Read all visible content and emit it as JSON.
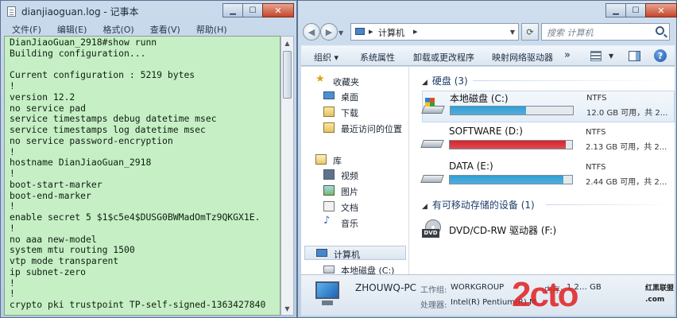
{
  "notepad": {
    "title": "dianjiaoguan.log - 记事本",
    "menu": [
      "文件(F)",
      "编辑(E)",
      "格式(O)",
      "查看(V)",
      "帮助(H)"
    ],
    "lines": [
      "DianJiaoGuan_2918#show runn",
      "Building configuration...",
      "",
      "Current configuration : 5219 bytes",
      "!",
      "version 12.2",
      "no service pad",
      "service timestamps debug datetime msec",
      "service timestamps log datetime msec",
      "no service password-encryption",
      "!",
      "hostname DianJiaoGuan_2918",
      "!",
      "boot-start-marker",
      "boot-end-marker",
      "!",
      "enable secret 5 $1$c5e4$DUSG0BWMadOmTz9QKGX1E.",
      "!",
      "no aaa new-model",
      "system mtu routing 1500",
      "vtp mode transparent",
      "ip subnet-zero",
      "!",
      "!",
      "crypto pki trustpoint TP-self-signed-1363427840"
    ]
  },
  "explorer": {
    "breadcrumb": "计算机",
    "search_placeholder": "搜索 计算机",
    "toolbar": [
      "组织",
      "系统属性",
      "卸载或更改程序",
      "映射网络驱动器"
    ],
    "more": "»",
    "nav": {
      "favorites": "收藏夹",
      "desktop": "桌面",
      "downloads": "下载",
      "recent": "最近访问的位置",
      "libraries": "库",
      "videos": "视频",
      "pictures": "图片",
      "documents": "文档",
      "music": "音乐",
      "computer": "计算机",
      "local_disk": "本地磁盘 (C:)"
    },
    "groups": {
      "hdd": "硬盘 (3)",
      "removable": "有可移动存储的设备 (1)"
    },
    "drives": [
      {
        "name": "本地磁盘 (C:)",
        "fs": "NTFS",
        "free": "12.0 GB 可用，共 2...",
        "used": 0.62,
        "color": "#2f9fd6"
      },
      {
        "name": "SOFTWARE (D:)",
        "fs": "NTFS",
        "free": "2.13 GB 可用，共 2...",
        "used": 0.95,
        "color": "#d8242b"
      },
      {
        "name": "DATA (E:)",
        "fs": "NTFS",
        "free": "2.44 GB 可用，共 2...",
        "used": 0.93,
        "color": "#2f9fd6"
      }
    ],
    "dvd": {
      "name": "DVD/CD-RW 驱动器 (F:)",
      "tag": "DVD"
    },
    "details": {
      "pc_name": "ZHOUWQ-PC",
      "workgroup_label": "工作组:",
      "workgroup": "WORKGROUP",
      "memory_label": "内存:",
      "memory": "1.2… GB",
      "cpu_label": "处理器:",
      "cpu": "Intel(R) Pentium(R) M..."
    }
  },
  "watermark": {
    "big": "2cto",
    "small": "红黑联盟\n.com"
  }
}
